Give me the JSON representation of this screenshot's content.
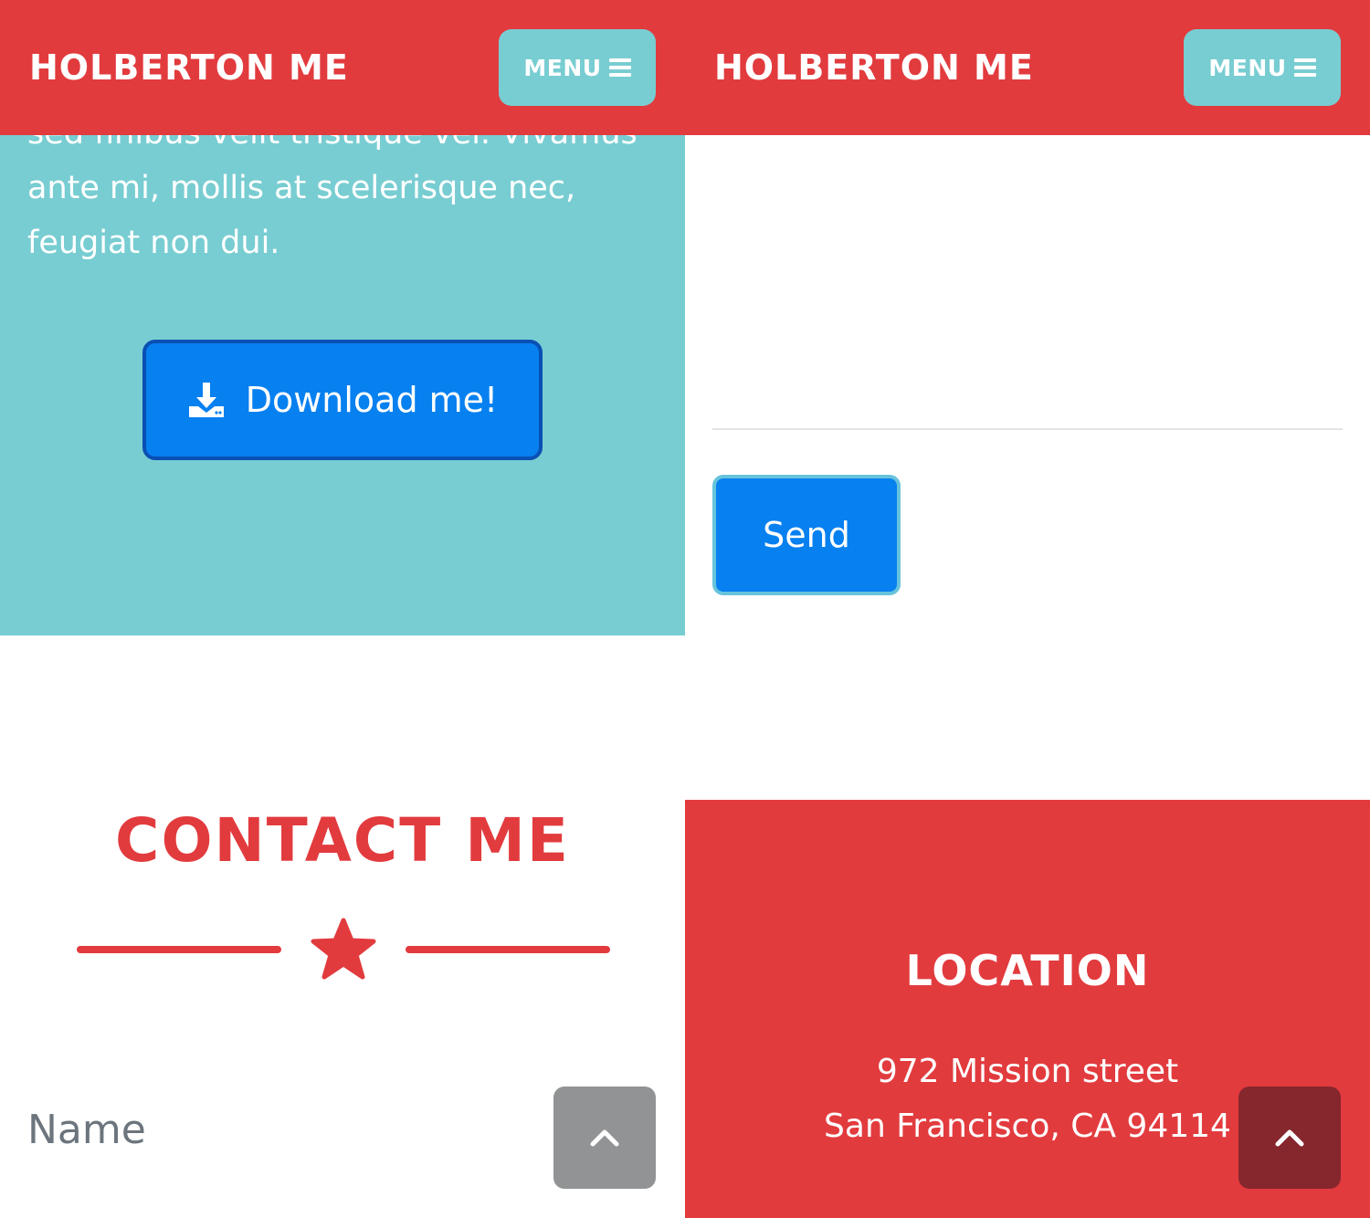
{
  "colors": {
    "brand_red": "#e23b3e",
    "teal": "#78cdd2",
    "primary_blue": "#0780f0",
    "gray_button": "#929394",
    "dark_red_button": "#86262d"
  },
  "navbar": {
    "brand": "HOLBERTON ME",
    "menu_label": "MENU",
    "menu_icon": "bars-icon"
  },
  "left": {
    "about_text": "sed finibus velit tristique vel. Vivamus ante mi, mollis at scelerisque nec, feugiat non dui.",
    "download_label": "Download me!",
    "download_icon": "download-icon",
    "contact_title": "CONTACT ME",
    "divider_icon": "star-icon",
    "name_label": "Name",
    "scroll_top_icon": "chevron-up-icon"
  },
  "right": {
    "send_label": "Send",
    "location_title": "LOCATION",
    "address_line1": "972 Mission street",
    "address_line2": "San Francisco, CA 94114",
    "scroll_top_icon": "chevron-up-icon"
  }
}
